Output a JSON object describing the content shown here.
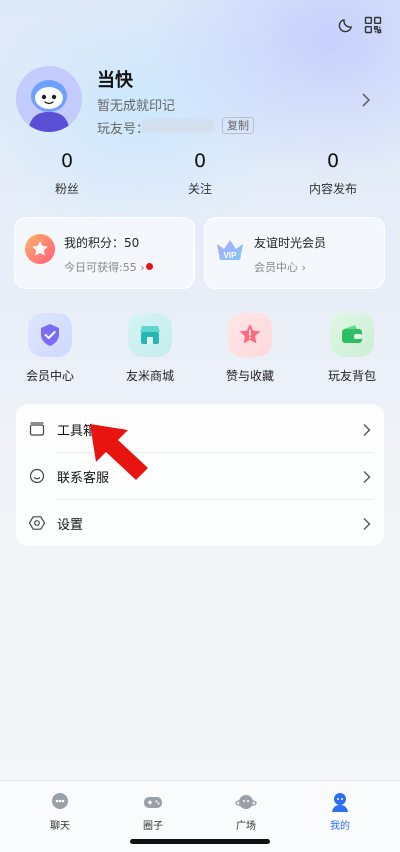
{
  "profile": {
    "name": "当快",
    "subtitle": "暂无成就印记",
    "uid_label": "玩友号：",
    "copy_label": "复制"
  },
  "stats": [
    {
      "value": "0",
      "label": "粉丝"
    },
    {
      "value": "0",
      "label": "关注"
    },
    {
      "value": "0",
      "label": "内容发布"
    }
  ],
  "cards": {
    "points": {
      "title": "我的积分：50",
      "subtitle": "今日可获得:55 ›"
    },
    "vip": {
      "title": "友谊时光会员",
      "subtitle": "会员中心 ›",
      "badge": "VIP"
    }
  },
  "quick_actions": [
    {
      "label": "会员中心",
      "icon": "shield-check-icon"
    },
    {
      "label": "友米商城",
      "icon": "shop-icon"
    },
    {
      "label": "赞与收藏",
      "icon": "star-icon"
    },
    {
      "label": "玩友背包",
      "icon": "wallet-icon"
    }
  ],
  "menu": [
    {
      "label": "工具箱",
      "icon": "toolbox-icon"
    },
    {
      "label": "联系客服",
      "icon": "headset-icon"
    },
    {
      "label": "设置",
      "icon": "settings-hexagon-icon"
    }
  ],
  "nav": [
    {
      "label": "聊天",
      "icon": "chat-icon",
      "active": false
    },
    {
      "label": "圈子",
      "icon": "gamepad-icon",
      "active": false
    },
    {
      "label": "广场",
      "icon": "planet-icon",
      "active": false
    },
    {
      "label": "我的",
      "icon": "profile-icon",
      "active": true
    }
  ],
  "colors": {
    "accent": "#2c6ff0",
    "arrow": "#e8140f",
    "red_dot": "#e8140f"
  }
}
